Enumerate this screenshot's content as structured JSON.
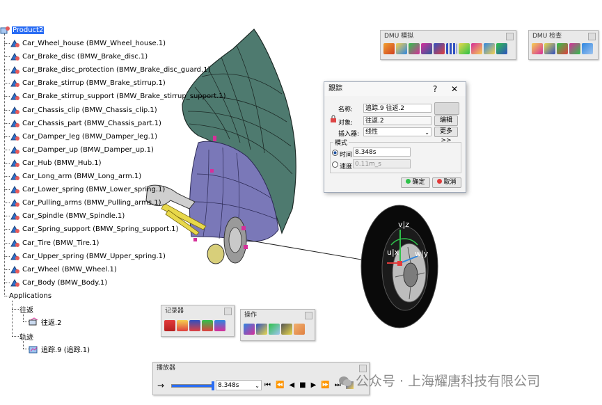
{
  "tree": {
    "root": "Product2",
    "parts": [
      "Car_Wheel_house (BMW_Wheel_house.1)",
      "Car_Brake_disc (BMW_Brake_disc.1)",
      "Car_Brake_disc_protection (BMW_Brake_disc_guard.1)",
      "Car_Brake_stirrup (BMW_Brake_stirrup.1)",
      "Car_Brake_stirrup_support (BMW_Brake_stirrup_support.1)",
      "Car_Chassis_clip (BMW_Chassis_clip.1)",
      "Car_Chassis_part (BMW_Chassis_part.1)",
      "Car_Damper_leg (BMW_Damper_leg.1)",
      "Car_Damper_up (BMW_Damper_up.1)",
      "Car_Hub (BMW_Hub.1)",
      "Car_Long_arm (BMW_Long_arm.1)",
      "Car_Lower_spring (BMW_Lower_spring.1)",
      "Car_Pulling_arms (BMW_Pulling_arms.1)",
      "Car_Spindle (BMW_Spindle.1)",
      "Car_Spring_support (BMW_Spring_support.1)",
      "Car_Tire (BMW_Tire.1)",
      "Car_Upper_spring (BMW_Upper_spring.1)",
      "Car_Wheel (BMW_Wheel.1)",
      "Car_Body (BMW_Body.1)"
    ],
    "applications": "Applications",
    "shuttle_group": "往返",
    "shuttle_item": "往返.2",
    "track_group": "轨迹",
    "track_item": "追踪.9 (追踪.1)"
  },
  "toolbars": {
    "dmu_sim": "DMU 模拟",
    "dmu_check": "DMU 检查",
    "recorder": "记录器",
    "operation": "操作",
    "player": "播放器"
  },
  "dialog": {
    "title": "跟踪",
    "help": "?",
    "close": "✕",
    "name_label": "名称:",
    "name_value": "追踪.9 往返.2",
    "object_label": "对象:",
    "object_value": "往返.2",
    "edit_button": "编辑",
    "interpolator_label": "插入器:",
    "interpolator_value": "线性",
    "more_button": "更多 >>",
    "mode_group": "模式",
    "time_label": "时间",
    "time_value": "8.348s",
    "speed_label": "速度",
    "speed_value": "0.11m_s",
    "ok_button": "确定",
    "cancel_button": "取消"
  },
  "player": {
    "time_value": "8.348s",
    "slider_fraction": 1.0
  },
  "axes": {
    "v_label": "v|z",
    "u_label": "u|x",
    "w_label": "w|y"
  },
  "watermark": "公众号 · 上海耀唐科技有限公司",
  "colors": {
    "fender": "#4e7a6f",
    "housing": "#7a78b8",
    "accent": "#d62f9a",
    "spring": "#e8d84a",
    "tire": "#0a0a0a",
    "selection": "#2a6df4"
  }
}
